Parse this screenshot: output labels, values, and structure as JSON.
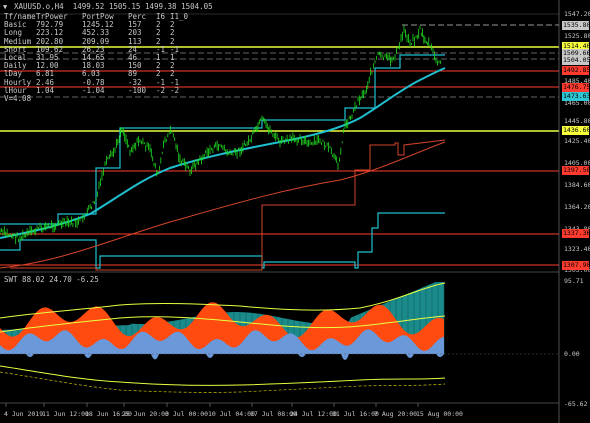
{
  "header": {
    "title": "XAUUSD.o,H4  1499.52 1505.15 1499.38 1504.05"
  },
  "stats": {
    "headers": [
      "Tf/name",
      "TrPower",
      "PortPow",
      "Perc",
      "I6",
      "I1_0"
    ],
    "rows": [
      [
        "Basic",
        "792.79",
        "1245.12",
        "157",
        "2",
        "2"
      ],
      [
        "Long",
        "223.12",
        "452.33",
        "203",
        "2",
        "2"
      ],
      [
        "Medium",
        "202.80",
        "209.09",
        "113",
        "2",
        "2"
      ],
      [
        "Short",
        "109.62",
        "26.23",
        "24",
        "-1",
        "-1"
      ],
      [
        "Local",
        "31.95",
        "14.65",
        "46",
        "1",
        "1"
      ],
      [
        "Daily",
        "12.00",
        "18.03",
        "150",
        "2",
        "2"
      ],
      [
        "lDay",
        "6.81",
        "6.03",
        "89",
        "2",
        "2"
      ],
      [
        "Hourly",
        "2.46",
        "-0.78",
        "-32",
        "-1",
        "-1"
      ],
      [
        "lHour",
        "1.04",
        "-1.04",
        "-100",
        "-2",
        "-2"
      ]
    ],
    "footer": "V=4.08"
  },
  "price_axis": {
    "labels": [
      "1547.20",
      "1525.80",
      "1504.05",
      "1485.40",
      "1465.00",
      "1445.80",
      "1425.40",
      "1405.00",
      "1384.60",
      "1364.20",
      "1343.80",
      "1323.40",
      "1303.00"
    ]
  },
  "price_tags": {
    "top_gray": "1535.80",
    "yellow_1": "1514.40",
    "gray_2": "1509.66",
    "current": "1504.05",
    "red_1": "1492.85",
    "red_2": "1476.75",
    "cyan_1": "1473.63",
    "yellow_2": "1436.60",
    "red_3": "1397.50",
    "red_4": "1337.36",
    "red_5": "1307.90"
  },
  "indicator": {
    "label": "SWT 88.02 24.70 -6.25",
    "axis_top": "95.71",
    "axis_mid": "0.00",
    "axis_bottom": "-65.62"
  },
  "dates": [
    "4 Jun 2019",
    "11 Jun 12:00",
    "18 Jun 16:00",
    "25 Jun 20:00",
    "3 Jul 00:00",
    "10 Jul 04:00",
    "17 Jul 08:00",
    "24 Jul 12:00",
    "31 Jul 16:00",
    "7 Aug 20:00",
    "15 Aug 00:00"
  ],
  "colors": {
    "background": "#000000",
    "candles": "#1fe01f",
    "ma_cyan": "#20c0d0",
    "ma_red": "#d2452a",
    "level_yellow": "#e8ff40",
    "level_red": "#ff3b2f",
    "level_cyan": "#20c0d0",
    "hist_orange": "#ff4a10",
    "hist_teal": "#1a8a8a",
    "hist_blue": "#6a98d8"
  }
}
